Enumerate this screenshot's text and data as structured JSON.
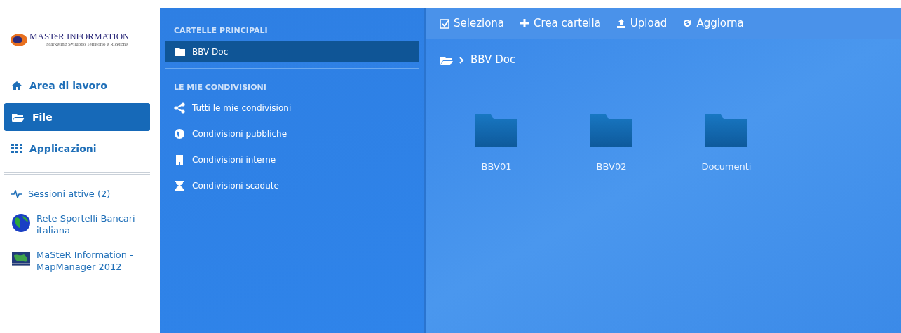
{
  "logo": {
    "title": "MASTeR INFORMATION",
    "subtitle": "Marketing Sviluppo Territorio e Ricerche"
  },
  "nav": [
    {
      "label": "Area di lavoro",
      "selected": false
    },
    {
      "label": "File",
      "selected": true
    },
    {
      "label": "Applicazioni",
      "selected": false
    }
  ],
  "sessions": {
    "label": "Sessioni attive (2)"
  },
  "apps": [
    {
      "label": "Rete Sportelli Bancari italiana -",
      "kind": "globe"
    },
    {
      "label": "MaSteR Information - MapManager 2012",
      "kind": "map"
    }
  ],
  "folders_panel": {
    "sections": [
      {
        "heading": "CARTELLE PRINCIPALI",
        "items": [
          {
            "label": "BBV Doc",
            "selected": true
          }
        ]
      },
      {
        "heading": "LE MIE CONDIVISIONI",
        "items": [
          {
            "label": "Tutti le mie condivisioni",
            "selected": false
          },
          {
            "label": "Condivisioni pubbliche",
            "selected": false
          },
          {
            "label": "Condivisioni interne",
            "selected": false
          },
          {
            "label": "Condivisioni scadute",
            "selected": false
          }
        ]
      }
    ]
  },
  "toolbar": [
    "Seleziona",
    "Crea cartella",
    "Upload",
    "Aggiorna"
  ],
  "breadcrumb": [
    "BBV Doc"
  ],
  "folders": [
    "BBV01",
    "BBV02",
    "Documenti"
  ]
}
